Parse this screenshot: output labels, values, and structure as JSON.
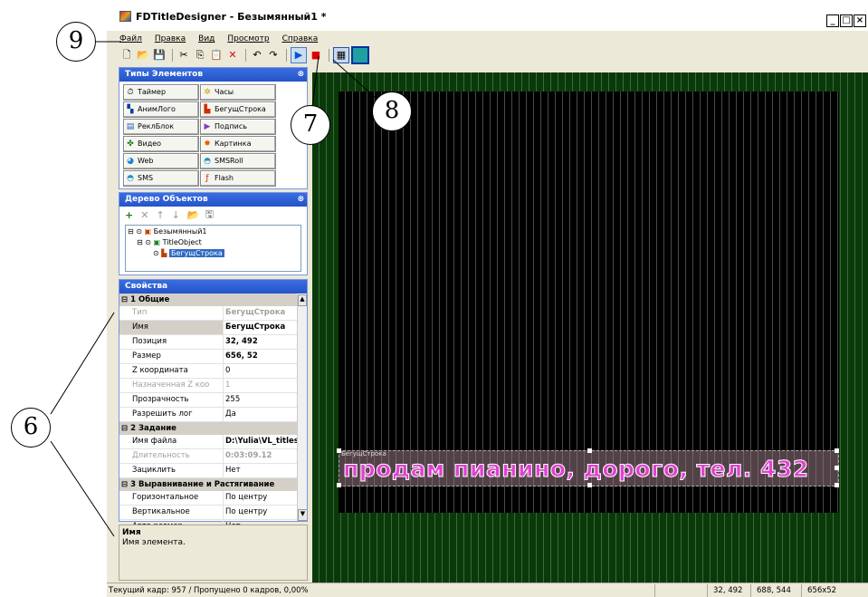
{
  "window": {
    "title": "FDTitleDesigner - Безымянный1 *"
  },
  "menu": [
    "Файл",
    "Правка",
    "Вид",
    "Просмотр",
    "Справка"
  ],
  "panels": {
    "element_types": {
      "title": "Типы Элементов",
      "items": [
        {
          "label": "Таймер",
          "icon": "timer-icon"
        },
        {
          "label": "Часы",
          "icon": "clock-icon"
        },
        {
          "label": "АнимЛого",
          "icon": "animlogo-icon"
        },
        {
          "label": "БегущСтрока",
          "icon": "ticker-icon"
        },
        {
          "label": "РеклБлок",
          "icon": "adblock-icon"
        },
        {
          "label": "Подпись",
          "icon": "caption-icon"
        },
        {
          "label": "Видео",
          "icon": "video-icon"
        },
        {
          "label": "Картинка",
          "icon": "picture-icon"
        },
        {
          "label": "Web",
          "icon": "web-icon"
        },
        {
          "label": "SMSRoll",
          "icon": "smsroll-icon"
        },
        {
          "label": "SMS",
          "icon": "sms-icon"
        },
        {
          "label": "Flash",
          "icon": "flash-icon"
        }
      ]
    },
    "object_tree": {
      "title": "Дерево Объектов",
      "nodes": [
        {
          "label": "Безымянный1"
        },
        {
          "label": "TitleObject"
        },
        {
          "label": "БегущСтрока"
        }
      ]
    },
    "properties": {
      "title": "Свойства",
      "categories": [
        {
          "name": "1 Общие",
          "rows": [
            {
              "key": "Тип",
              "value": "БегущСтрока"
            },
            {
              "key": "Имя",
              "value": "БегущСтрока"
            },
            {
              "key": "Позиция",
              "value": "32, 492"
            },
            {
              "key": "Размер",
              "value": "656, 52"
            },
            {
              "key": "Z координата",
              "value": "0"
            },
            {
              "key": "Назначенная Z коо",
              "value": "1"
            },
            {
              "key": "Прозрачность",
              "value": "255"
            },
            {
              "key": "Разрешить лог",
              "value": "Да"
            }
          ]
        },
        {
          "name": "2 Задание",
          "rows": [
            {
              "key": "Имя файла",
              "value": "D:\\Yulia\\VL_titles\\Б"
            },
            {
              "key": "Длительность",
              "value": "0:03:09.12"
            },
            {
              "key": "Зациклить",
              "value": "Нет"
            }
          ]
        },
        {
          "name": "3 Выравнивание и Растягивание",
          "rows": [
            {
              "key": "Горизонтальное",
              "value": "По центру"
            },
            {
              "key": "Вертикальное",
              "value": "По центру"
            },
            {
              "key": "Авто размер",
              "value": "Нет"
            }
          ]
        }
      ]
    },
    "description": {
      "title": "Имя",
      "text": "Имя элемента."
    }
  },
  "canvas": {
    "marquee_text": "продам пианино, дорого, тел. 432",
    "marquee_label": "БегущСтрока"
  },
  "status": {
    "frame": "Текущий кадр: 957 / Пропущено 0 кадров, 0,00%",
    "pos": "32, 492",
    "pos2": "688, 544",
    "size": "656x52"
  },
  "callouts": [
    "9",
    "7",
    "8",
    "6"
  ]
}
